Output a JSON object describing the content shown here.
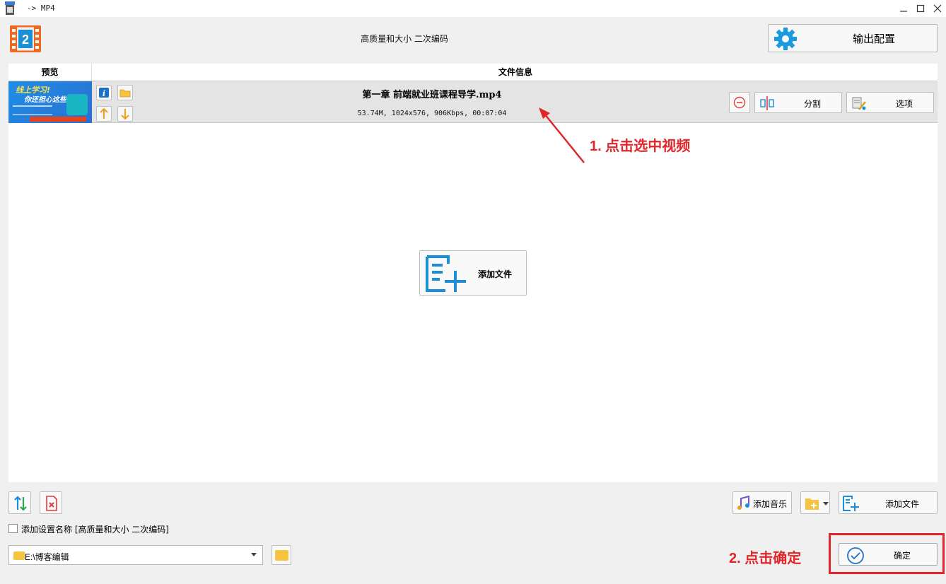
{
  "window": {
    "title": "-> MP4",
    "minimize_icon": "minimize-icon",
    "maximize_icon": "maximize-icon",
    "close_icon": "close-icon"
  },
  "header": {
    "preset_title": "高质量和大小 二次编码",
    "output_config_label": "输出配置"
  },
  "list": {
    "col_preview": "预览",
    "col_info": "文件信息",
    "files": [
      {
        "thumb_text_1": "线上学习!",
        "thumb_text_2": "你还担心这些?",
        "name": "第一章 前端就业班课程导学.mp4",
        "meta": "53.74M, 1024x576, 906Kbps, 00:07:04",
        "split_label": "分割",
        "options_label": "选项"
      }
    ],
    "add_file_center_label": "添加文件"
  },
  "annotations": {
    "step1": "1. 点击选中视频",
    "step2": "2. 点击确定",
    "color": "#e0262a"
  },
  "toolbar": {
    "add_music_label": "添加音乐",
    "add_file_label": "添加文件"
  },
  "options": {
    "add_setting_name_label": "添加设置名称 [高质量和大小 二次编码]",
    "add_setting_name_checked": false
  },
  "output": {
    "path": "E:\\博客编辑",
    "ok_label": "确定"
  },
  "colors": {
    "accent_blue": "#1a8fd6",
    "logo_orange": "#f0691e",
    "folder_yellow": "#f5c542"
  }
}
